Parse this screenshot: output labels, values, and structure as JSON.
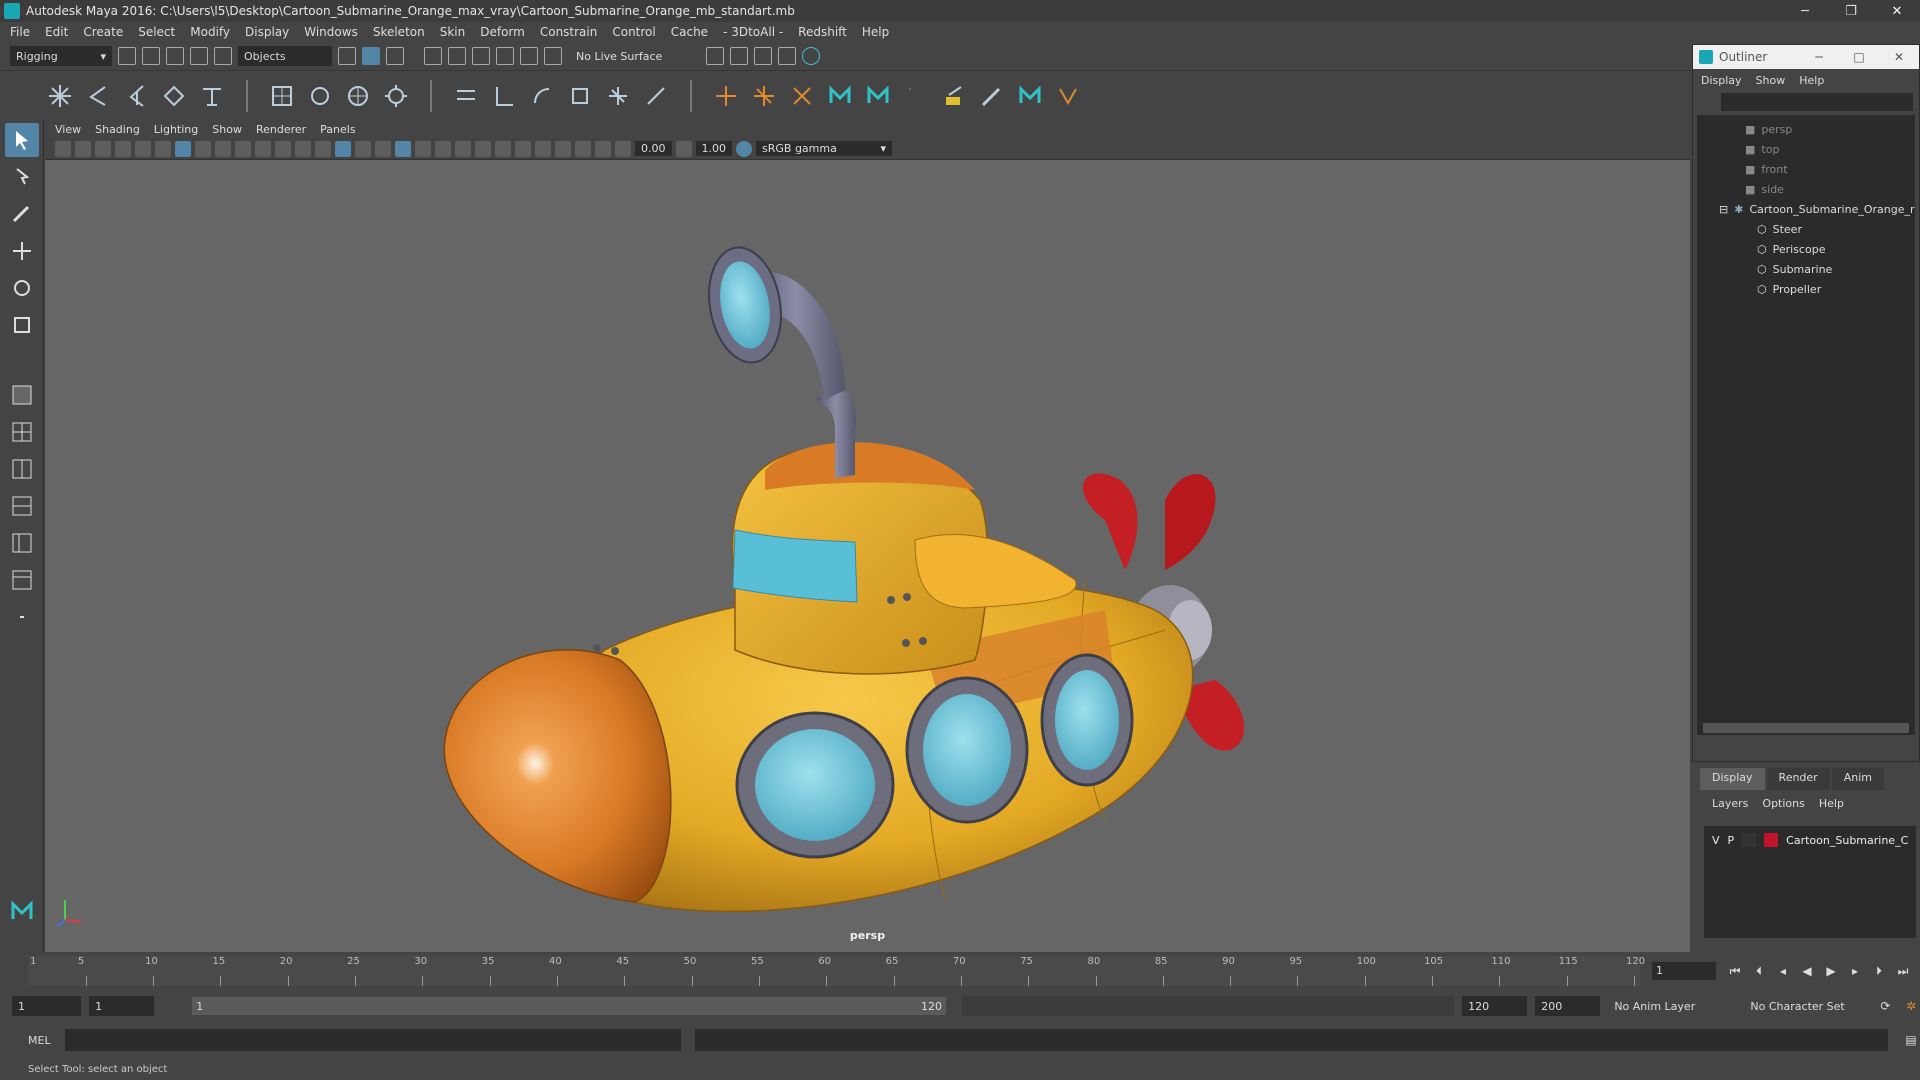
{
  "titlebar": {
    "title": "Autodesk Maya 2016: C:\\Users\\l5\\Desktop\\Cartoon_Submarine_Orange_max_vray\\Cartoon_Submarine_Orange_mb_standart.mb",
    "minimize": "─",
    "restore": "❐",
    "close": "✕"
  },
  "menubar": [
    "File",
    "Edit",
    "Create",
    "Select",
    "Modify",
    "Display",
    "Windows",
    "Skeleton",
    "Skin",
    "Deform",
    "Constrain",
    "Control",
    "Cache",
    "- 3DtoAll -",
    "Redshift",
    "Help"
  ],
  "status": {
    "menuset": "Rigging",
    "selection_mode": "Objects",
    "live_surface": "No Live Surface"
  },
  "viewport": {
    "menu": [
      "View",
      "Shading",
      "Lighting",
      "Show",
      "Renderer",
      "Panels"
    ],
    "exposure": "0.00",
    "gamma": "1.00",
    "colorspace": "sRGB gamma",
    "camera": "persp"
  },
  "outliner": {
    "title": "Outliner",
    "menu": [
      "Display",
      "Show",
      "Help"
    ],
    "cameras": [
      "persp",
      "top",
      "front",
      "side"
    ],
    "group": "Cartoon_Submarine_Orange_r",
    "children": [
      "Steer",
      "Periscope",
      "Submarine",
      "Propeller"
    ]
  },
  "layers": {
    "tabs": [
      "Display",
      "Render",
      "Anim"
    ],
    "menu": [
      "Layers",
      "Options",
      "Help"
    ],
    "visible": "V",
    "playback": "P",
    "layer_name": "Cartoon_Submarine_C",
    "layer_color": "#c0142c"
  },
  "timeline": {
    "ticks": [
      5,
      10,
      15,
      20,
      25,
      30,
      35,
      40,
      45,
      50,
      55,
      60,
      65,
      70,
      75,
      80,
      85,
      90,
      95,
      100,
      105,
      110,
      115,
      120
    ],
    "first_tick": "1",
    "current_frame": "1"
  },
  "range": {
    "start": "1",
    "playback_start": "1",
    "slider_start": "1",
    "slider_end": "120",
    "playback_end": "120",
    "end": "200",
    "anim_layer": "No Anim Layer",
    "character_set": "No Character Set"
  },
  "command": {
    "label": "MEL"
  },
  "help": {
    "text": "Select Tool: select an object"
  }
}
